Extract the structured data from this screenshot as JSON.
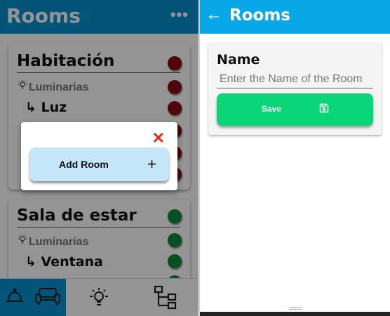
{
  "left": {
    "header": {
      "title": "Rooms",
      "menu_icon": "more-horizontal-icon",
      "menu_glyph": "•••"
    },
    "rooms": [
      {
        "name": "Habitación",
        "status_color": "#8b0a10",
        "rows": [
          {
            "type": "group",
            "label": "Luminarias",
            "icon": "bulb-icon",
            "status_color": "#8b0a10"
          },
          {
            "type": "device",
            "label": "Luz",
            "prefix": "↳",
            "status_color": "#8b0a10"
          }
        ]
      },
      {
        "name": "Sala de estar",
        "status_color": "#0a8a3c",
        "rows": [
          {
            "type": "group",
            "label": "Luminarias",
            "icon": "bulb-icon",
            "status_color": "#0a8a3c"
          },
          {
            "type": "device",
            "label": "Ventana",
            "prefix": "↳",
            "status_color": "#0a8a3c"
          }
        ]
      }
    ],
    "bottom_nav": [
      {
        "name": "rooms-nav",
        "icons": [
          "bell-icon",
          "sofa-icon"
        ],
        "active": true
      },
      {
        "name": "lights-nav",
        "icons": [
          "bulb-icon"
        ],
        "active": false
      },
      {
        "name": "network-nav",
        "icons": [
          "network-tree-icon"
        ],
        "active": false
      }
    ],
    "modal": {
      "close_glyph": "✕",
      "add_room_label": "Add Room",
      "add_room_glyph": "+"
    }
  },
  "right": {
    "header": {
      "back_glyph": "←",
      "title": "Rooms"
    },
    "form": {
      "label": "Name",
      "input_placeholder": "Enter the Name of the Room",
      "input_value": "",
      "save_label": "Save",
      "save_icon": "floppy-disk-icon"
    }
  },
  "colors": {
    "left_header": "#0891d1",
    "right_header": "#0aa7e8",
    "status_off": "#8b0a10",
    "status_on": "#0a8a3c",
    "save_button": "#08d678",
    "add_room_button": "#c4e6f8",
    "close_red": "#e32b1f"
  }
}
